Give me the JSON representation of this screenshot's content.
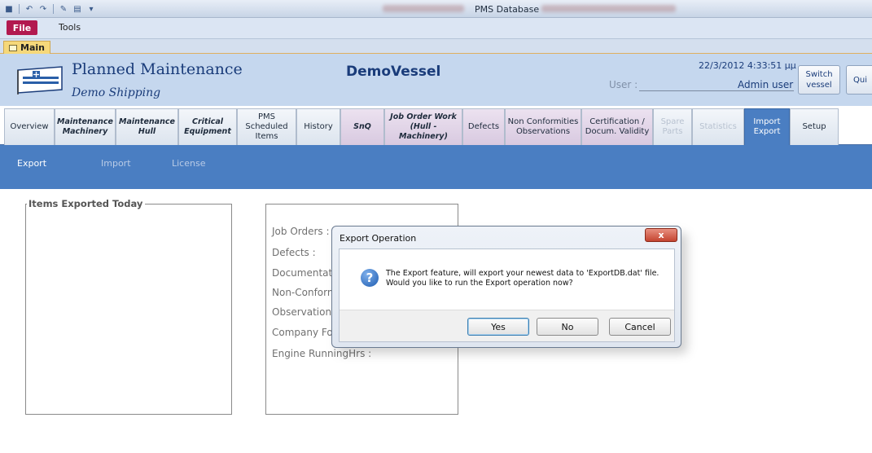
{
  "window": {
    "title": "PMS Database"
  },
  "ribbon": {
    "file_label": "File",
    "tools_label": "Tools"
  },
  "doc_tab": {
    "label": "Main"
  },
  "header": {
    "org_title": "Planned Maintenance",
    "company": "Demo Shipping",
    "vessel": "DemoVessel",
    "datetime": "22/3/2012 4:33:51 μμ",
    "user_label": "User :",
    "user_value": "Admin user",
    "switch_vessel_line1": "Switch",
    "switch_vessel_line2": "vessel",
    "quit_label": "Qui"
  },
  "nav_tabs": [
    {
      "line1": "Overview",
      "line2": ""
    },
    {
      "line1": "Maintenance",
      "line2": "Machinery"
    },
    {
      "line1": "Maintenance",
      "line2": "Hull"
    },
    {
      "line1": "Critical",
      "line2": "Equipment"
    },
    {
      "line1": "PMS",
      "line2": "Scheduled",
      "line3": "Items"
    },
    {
      "line1": "History",
      "line2": ""
    },
    {
      "line1": "SnQ",
      "line2": ""
    },
    {
      "line1": "Job Order Work",
      "line2": "(Hull - Machinery)"
    },
    {
      "line1": "Defects",
      "line2": ""
    },
    {
      "line1": "Non Conformities",
      "line2": "Observations"
    },
    {
      "line1": "Certification /",
      "line2": "Docum. Validity"
    },
    {
      "line1": "Spare",
      "line2": "Parts"
    },
    {
      "line1": "Statistics",
      "line2": ""
    },
    {
      "line1": "Import",
      "line2": "Export"
    },
    {
      "line1": "Setup",
      "line2": ""
    }
  ],
  "sub_nav": [
    {
      "label": "Export"
    },
    {
      "label": "Import"
    },
    {
      "label": "License"
    }
  ],
  "items_exported": {
    "title": "Items Exported Today"
  },
  "fields": [
    {
      "label": "Job Orders :"
    },
    {
      "label": "Defects :"
    },
    {
      "label": "Documentati"
    },
    {
      "label": "Non-Conform"
    },
    {
      "label": "Observations"
    },
    {
      "label": "Company For"
    },
    {
      "label": "Engine RunningHrs :"
    }
  ],
  "dialog": {
    "title": "Export Operation",
    "close_label": "x",
    "message_line1": "The Export feature, will export your newest data to 'ExportDB.dat' file.",
    "message_line2": "Would you like to run the Export operation now?",
    "yes_label": "Yes",
    "no_label": "No",
    "cancel_label": "Cancel"
  },
  "colors": {
    "file_tab": "#b2194f",
    "header_bg": "#c5d7ee",
    "accent_blue": "#4a7ec2",
    "title_text": "#1a3c7a"
  }
}
